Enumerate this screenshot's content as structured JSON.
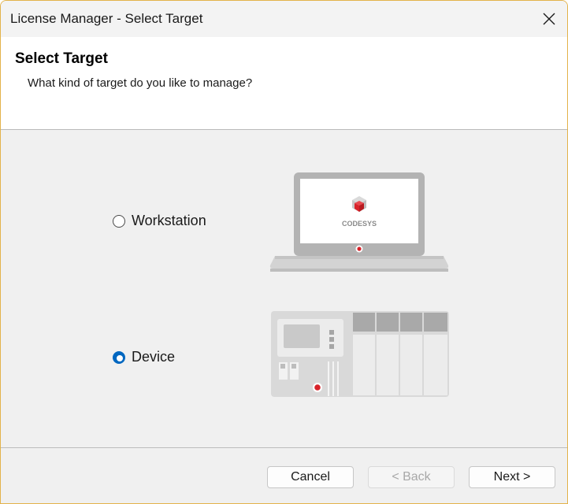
{
  "window": {
    "title": "License Manager - Select Target",
    "close_icon": "close-icon"
  },
  "header": {
    "title": "Select Target",
    "subtitle": "What kind of target do you like to manage?"
  },
  "options": {
    "workstation": {
      "label": "Workstation",
      "selected": false,
      "illustration": "laptop-icon",
      "logo_text": "CODESYS"
    },
    "device": {
      "label": "Device",
      "selected": true,
      "illustration": "plc-device-icon"
    }
  },
  "footer": {
    "cancel_label": "Cancel",
    "back_label": "< Back",
    "back_enabled": false,
    "next_label": "Next >"
  },
  "colors": {
    "accent": "#0067c0",
    "brand_red": "#d8232a",
    "window_border": "#e3b34a"
  }
}
